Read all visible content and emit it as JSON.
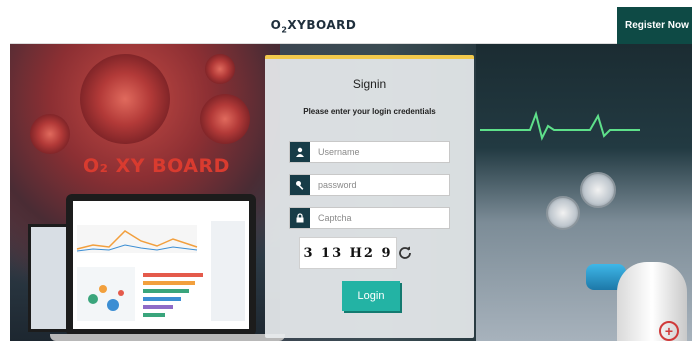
{
  "header": {
    "brand_main": "O",
    "brand_sub": "2",
    "brand_rest": "XYBOARD",
    "register_label": "Register Now"
  },
  "hero": {
    "overlay_brand": "O₂ XY BOARD"
  },
  "signin": {
    "title": "Signin",
    "subtitle": "Please enter your login credentials",
    "username_placeholder": "Username",
    "password_placeholder": "password",
    "captcha_placeholder": "Captcha",
    "captcha_text": "3 13 H2 9",
    "login_label": "Login"
  },
  "icons": {
    "username": "user-icon",
    "password": "key-icon",
    "captcha": "lock-icon",
    "refresh": "refresh-icon"
  },
  "colors": {
    "accent": "#23b3a4",
    "header_button": "#0e4a45",
    "icon_box": "#173c47",
    "card_top": "#f2c94c"
  }
}
